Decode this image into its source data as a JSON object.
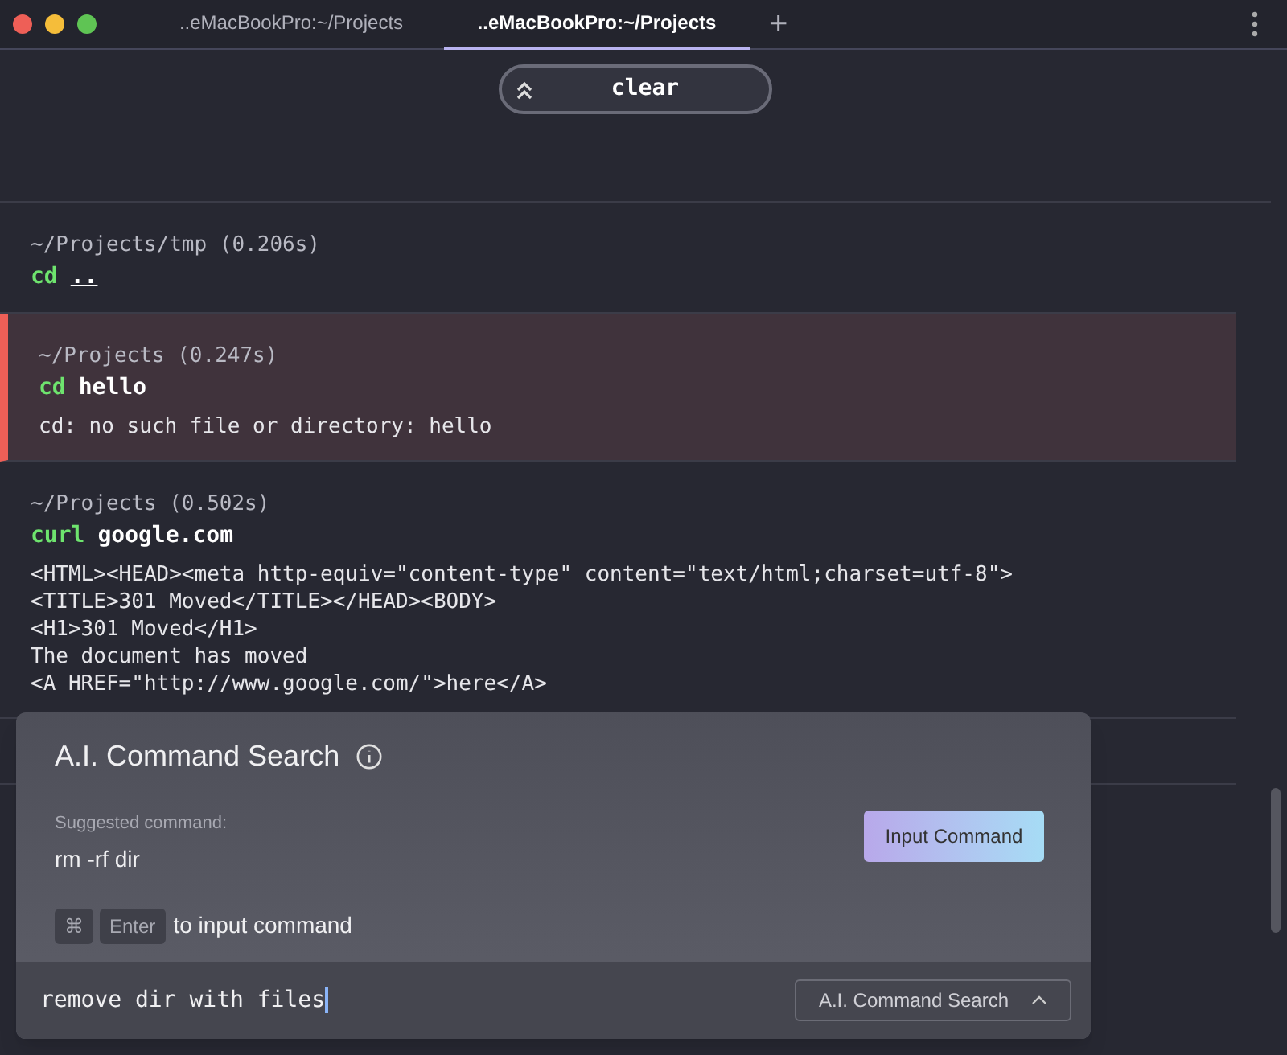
{
  "window": {
    "tabs": [
      {
        "label": "..eMacBookPro:~/Projects",
        "selected": false
      },
      {
        "label": "..eMacBookPro:~/Projects",
        "selected": true
      }
    ],
    "new_tab": "+"
  },
  "sticky_command": {
    "label": "clear"
  },
  "blocks": [
    {
      "prompt": "~/Projects/tmp (0.206s)",
      "command": "cd",
      "argument": "..",
      "argument_underlined": true,
      "error": false
    },
    {
      "prompt": "~/Projects (0.247s)",
      "command": "cd",
      "argument": "hello",
      "argument_underlined": false,
      "error": true,
      "output": [
        "cd: no such file or directory: hello"
      ]
    },
    {
      "prompt": "~/Projects (0.502s)",
      "command": "curl",
      "argument": "google.com",
      "argument_underlined": false,
      "error": false,
      "output": [
        "<HTML><HEAD><meta http-equiv=\"content-type\" content=\"text/html;charset=utf-8\">",
        "<TITLE>301 Moved</TITLE></HEAD><BODY>",
        "<H1>301 Moved</H1>",
        "The document has moved",
        "<A HREF=\"http://www.google.com/\">here</A>"
      ]
    }
  ],
  "ai_search": {
    "title": "A.I. Command Search",
    "suggested_label": "Suggested command:",
    "suggested_command": "rm -rf dir",
    "input_button": "Input Command",
    "keys": [
      "⌘",
      "Enter"
    ],
    "hint": "to input command",
    "query": "remove dir with files",
    "mode_button": "A.I. Command Search"
  }
}
